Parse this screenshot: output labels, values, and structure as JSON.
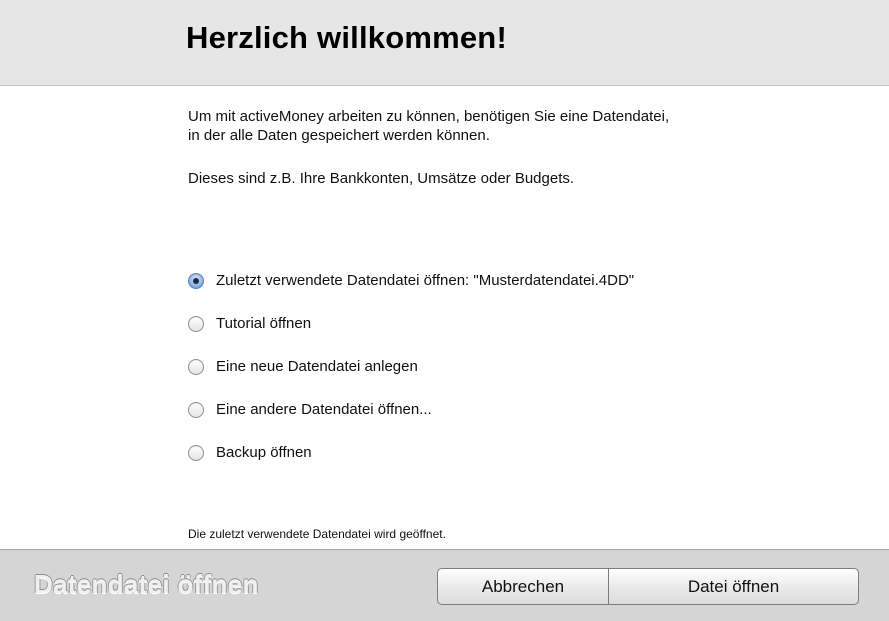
{
  "header": {
    "title": "Herzlich willkommen!"
  },
  "intro": {
    "paragraph1_line1": "Um mit activeMoney arbeiten zu können, benötigen Sie eine Datendatei,",
    "paragraph1_line2": "in der alle Daten gespeichert werden können.",
    "paragraph2": "Dieses sind z.B. Ihre Bankkonten, Umsätze oder Budgets."
  },
  "options": [
    {
      "label": "Zuletzt verwendete Datendatei öffnen: \"Musterdatendatei.4DD\"",
      "selected": true
    },
    {
      "label": "Tutorial öffnen",
      "selected": false
    },
    {
      "label": "Eine neue Datendatei anlegen",
      "selected": false
    },
    {
      "label": "Eine andere Datendatei öffnen...",
      "selected": false
    },
    {
      "label": "Backup öffnen",
      "selected": false
    }
  ],
  "status_text": "Die zuletzt verwendete Datendatei wird geöffnet.",
  "footer": {
    "title": "Datendatei öffnen",
    "cancel_label": "Abbrechen",
    "open_label": "Datei öffnen"
  }
}
